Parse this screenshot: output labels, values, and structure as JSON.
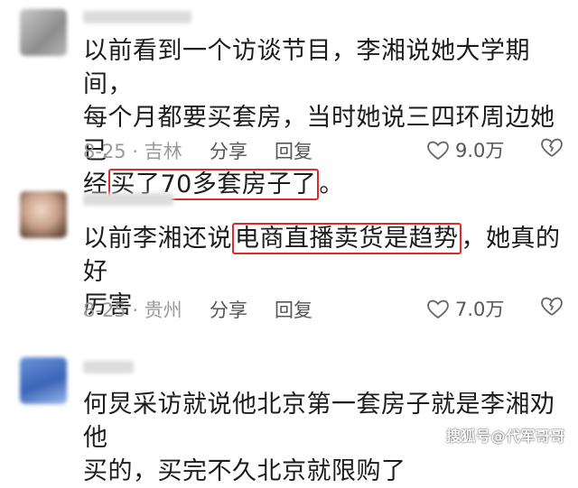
{
  "comments": [
    {
      "line1": "以前看到一个访谈节目，李湘说她大学期间，",
      "line2": "每个月都要买套房，当时她说三四环周边她已",
      "line3_prefix": "经",
      "line3_highlight": "买了70多套房子了",
      "line3_suffix": "。",
      "date": "8-25 · 吉林",
      "share": "分享",
      "reply": "回复",
      "likes": "9.0万"
    },
    {
      "line1_prefix": "以前李湘还说",
      "line1_highlight": "电商直播卖货是趋势",
      "line1_suffix": "，她真的好",
      "line2": "厉害",
      "date": "8-25 · 贵州",
      "share": "分享",
      "reply": "回复",
      "likes": "7.0万"
    },
    {
      "line1": "何炅采访就说他北京第一套房子就是李湘劝他",
      "line2": "买的，买完不久北京就限购了"
    }
  ],
  "watermark": "搜狐号@代军哥哥",
  "colors": {
    "highlight_box": "#e02a2a",
    "meta_text": "#9a9a9a"
  }
}
